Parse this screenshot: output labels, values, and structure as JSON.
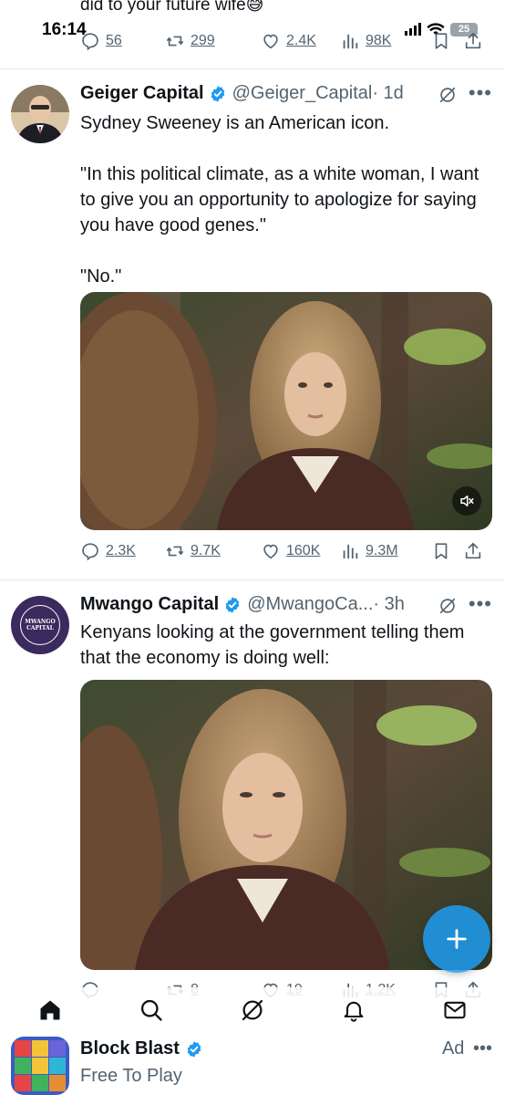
{
  "status_bar": {
    "time": "16:14",
    "battery": "25"
  },
  "prev_tweet": {
    "text_fragment": "did to your future wife😅",
    "replies": "56",
    "reposts": "299",
    "likes": "2.4K",
    "views": "98K"
  },
  "tweets": [
    {
      "name": "Geiger Capital",
      "handle": "@Geiger_Capital",
      "time": "· 1d",
      "text": "Sydney Sweeney is an American icon.\n\n\"In this political climate, as a white woman, I want to give you an opportunity to apologize for saying you have good genes.\"\n\n\"No.\"",
      "replies": "2.3K",
      "reposts": "9.7K",
      "likes": "160K",
      "views": "9.3M"
    },
    {
      "name": "Mwango Capital",
      "handle": "@MwangoCa...",
      "time": "· 3h",
      "text": "Kenyans looking at the government telling them that the economy is doing well:",
      "avatar_text_1": "MWANGO",
      "avatar_text_2": "CAPITAL",
      "replies": "",
      "reposts": "8",
      "likes": "19",
      "views": "1.2K"
    }
  ],
  "ad": {
    "title": "Block Blast",
    "subtitle": "Free To Play",
    "tag": "Ad"
  },
  "colors": {
    "accent": "#1d9bf0",
    "secondary_text": "#536471",
    "mwango_purple": "#3b2a5e"
  }
}
